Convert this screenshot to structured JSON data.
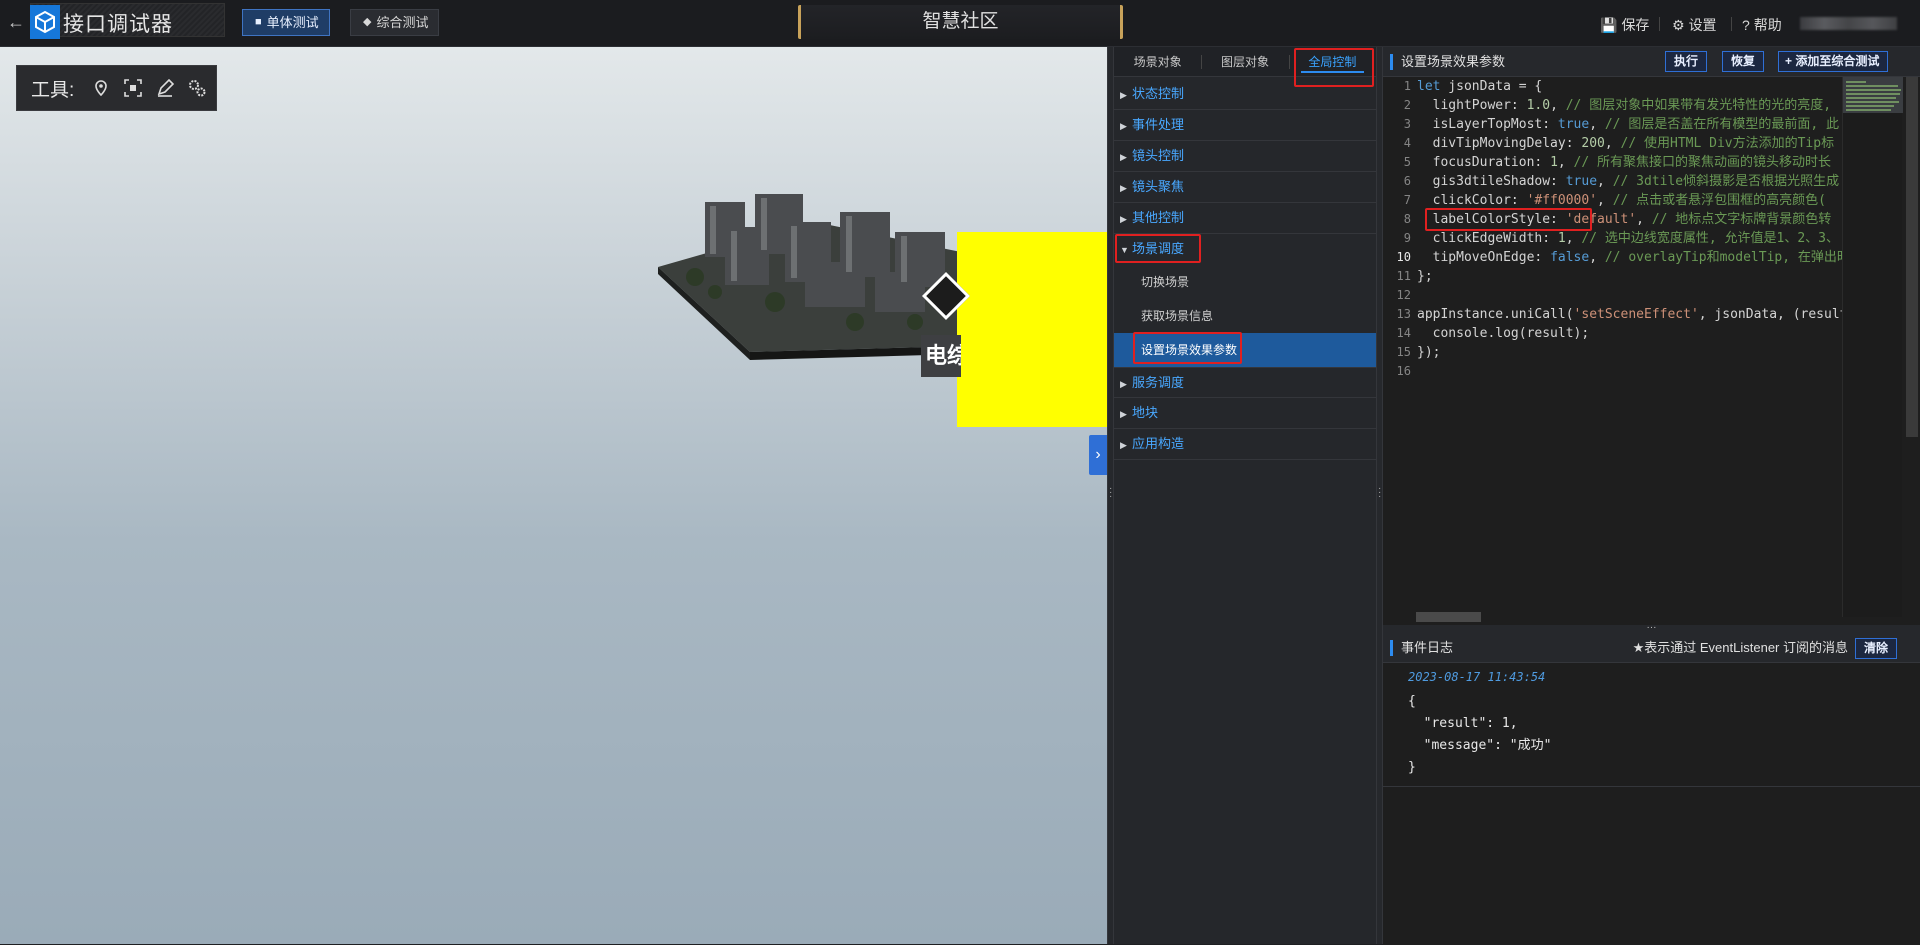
{
  "topbar": {
    "app_title": "接口调试器",
    "mode_buttons": [
      "单体测试",
      "综合测试"
    ],
    "center_title": "智慧社区",
    "actions": {
      "save": "保存",
      "settings": "设置",
      "help": "帮助"
    }
  },
  "viewport": {
    "tools_label": "工具:",
    "overlay_label": "电综"
  },
  "middle_panel": {
    "tabs": [
      "场景对象",
      "图层对象",
      "全局控制"
    ],
    "active_tab": "全局控制",
    "tree": [
      {
        "label": "状态控制"
      },
      {
        "label": "事件处理"
      },
      {
        "label": "镜头控制"
      },
      {
        "label": "镜头聚焦"
      },
      {
        "label": "其他控制"
      },
      {
        "label": "场景调度",
        "expanded": true,
        "children": [
          "切换场景",
          "获取场景信息",
          "设置场景效果参数"
        ],
        "selected_child": "设置场景效果参数"
      },
      {
        "label": "服务调度"
      },
      {
        "label": "地块"
      },
      {
        "label": "应用构造"
      }
    ]
  },
  "right_panel": {
    "title": "设置场景效果参数",
    "buttons": {
      "run": "执行",
      "reset": "恢复",
      "add": "添加至综合测试"
    },
    "current_line": 10,
    "code_lines": [
      "let jsonData = {",
      "  lightPower: 1.0, // 图层对象中如果带有发光特性的光的亮度,",
      "  isLayerTopMost: true, // 图层是否盖在所有模型的最前面, 此",
      "  divTipMovingDelay: 200, // 使用HTML Div方法添加的Tip标",
      "  focusDuration: 1, // 所有聚焦接口的聚焦动画的镜头移动时长",
      "  gis3dtileShadow: true, // 3dtile倾斜摄影是否根据光照生成",
      "  clickColor: '#ff0000', // 点击或者悬浮包围框的高亮颜色(",
      "  labelColorStyle: 'default', // 地标点文字标牌背景颜色转",
      "  clickEdgeWidth: 1, // 选中边线宽度属性, 允许值是1、2、3、",
      "  tipMoveOnEdge: false, // overlayTip和modelTip, 在弹出时",
      "};",
      "",
      "appInstance.uniCall('setSceneEffect', jsonData, (result",
      "  console.log(result);",
      "});",
      ""
    ],
    "log": {
      "title": "事件日志",
      "hint": "★表示通过 EventListener 订阅的消息",
      "clear_label": "清除",
      "timestamp": "2023-08-17 11:43:54",
      "json_lines": [
        "{",
        "  \"result\": 1,",
        "  \"message\": \"成功\"",
        "}"
      ]
    }
  },
  "colors": {
    "accent": "#2d8cf0",
    "link": "#49a8ff",
    "highlight_box": "#e02020",
    "overlay_yellow": "#ffff00"
  }
}
